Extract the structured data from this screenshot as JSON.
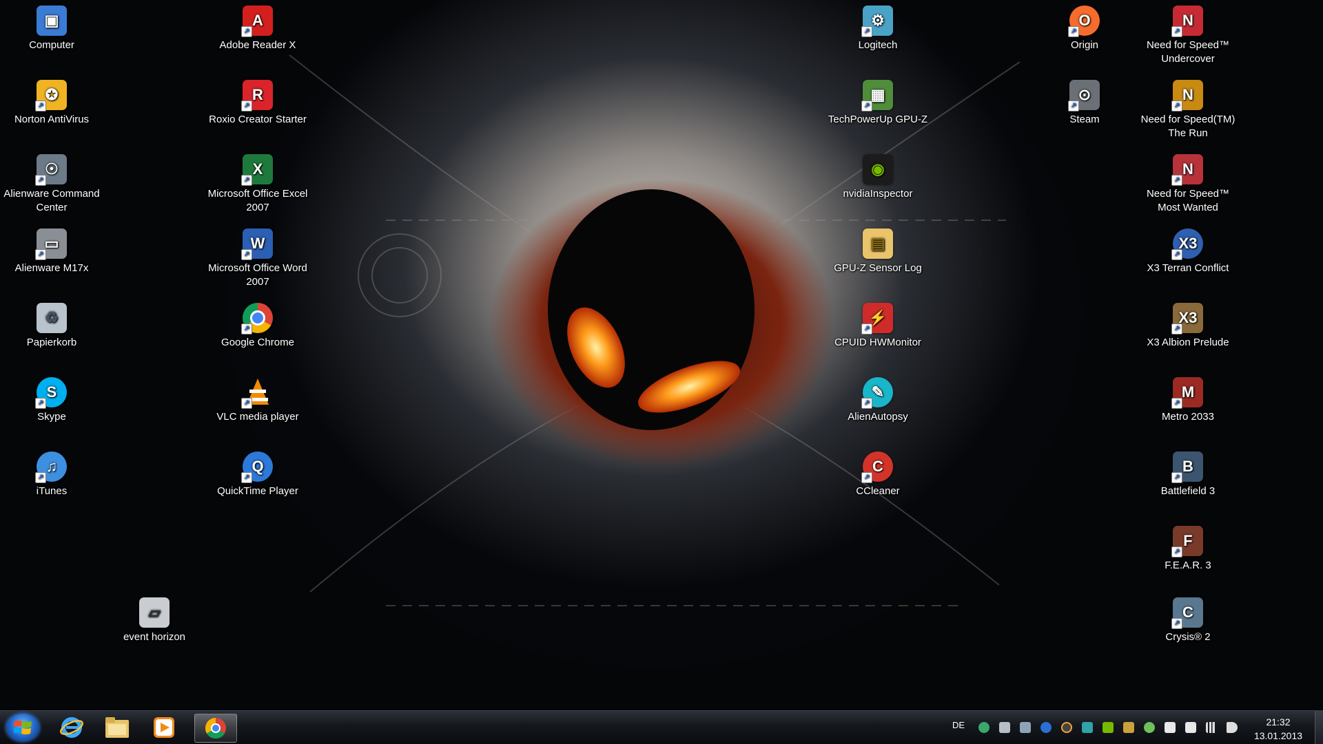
{
  "desktop": {
    "icons": [
      {
        "label": "Computer",
        "icon": "computer-icon",
        "color": "#3a7bd5"
      },
      {
        "label": "Norton AntiVirus",
        "icon": "norton-icon",
        "color": "#f0b323"
      },
      {
        "label": "Alienware Command Center",
        "icon": "alienware-cc-icon",
        "color": "#6d7a88"
      },
      {
        "label": "Alienware M17x",
        "icon": "laptop-icon",
        "color": "#8a8f96"
      },
      {
        "label": "Papierkorb",
        "icon": "recycle-bin-icon",
        "color": "#b9c3cc"
      },
      {
        "label": "Skype",
        "icon": "skype-icon",
        "color": "#00aff0"
      },
      {
        "label": "iTunes",
        "icon": "itunes-icon",
        "color": "#3d8fe0"
      },
      {
        "label": "Adobe Reader X",
        "icon": "adobe-reader-icon",
        "color": "#d3201f"
      },
      {
        "label": "Roxio Creator Starter",
        "icon": "roxio-icon",
        "color": "#d8242a"
      },
      {
        "label": "Microsoft Office Excel 2007",
        "icon": "excel-icon",
        "color": "#1e7a3c"
      },
      {
        "label": "Microsoft Office Word 2007",
        "icon": "word-icon",
        "color": "#2a5fb3"
      },
      {
        "label": "Google Chrome",
        "icon": "chrome-icon",
        "color": "#3d8b3d"
      },
      {
        "label": "VLC media player",
        "icon": "vlc-icon",
        "color": "#f28a00"
      },
      {
        "label": "QuickTime Player",
        "icon": "quicktime-icon",
        "color": "#2c79d9"
      },
      {
        "label": "event horizon",
        "icon": "monitor-icon",
        "color": "#c9ccd0"
      },
      {
        "label": "Logitech",
        "icon": "logitech-icon",
        "color": "#4aa3c7"
      },
      {
        "label": "TechPowerUp GPU-Z",
        "icon": "gpu-z-icon",
        "color": "#4f8d3a"
      },
      {
        "label": "nvidiaInspector",
        "icon": "nvidia-icon",
        "color": "#76b900"
      },
      {
        "label": "GPU-Z Sensor Log",
        "icon": "folder-icon",
        "color": "#e9c46a"
      },
      {
        "label": "CPUID HWMonitor",
        "icon": "hwmonitor-icon",
        "color": "#d02b2b"
      },
      {
        "label": "AlienAutopsy",
        "icon": "alienautopsy-icon",
        "color": "#19b5c9"
      },
      {
        "label": "CCleaner",
        "icon": "ccleaner-icon",
        "color": "#d2342a"
      },
      {
        "label": "Origin",
        "icon": "origin-icon",
        "color": "#f56c2d"
      },
      {
        "label": "Steam",
        "icon": "steam-icon",
        "color": "#6b7077"
      },
      {
        "label": "Need for Speed™ Undercover",
        "icon": "nfs-undercover-icon",
        "color": "#c62b35"
      },
      {
        "label": "Need for Speed(TM) The Run",
        "icon": "nfs-the-run-icon",
        "color": "#c98a12"
      },
      {
        "label": "Need for Speed™ Most Wanted",
        "icon": "nfs-most-wanted-icon",
        "color": "#b8323a"
      },
      {
        "label": "X3 Terran Conflict",
        "icon": "x3-terran-conflict-icon",
        "color": "#2f5fb0"
      },
      {
        "label": "X3 Albion Prelude",
        "icon": "x3-albion-prelude-icon",
        "color": "#8a6a3a"
      },
      {
        "label": "Metro 2033",
        "icon": "metro-2033-icon",
        "color": "#9b2a22"
      },
      {
        "label": "Battlefield 3",
        "icon": "battlefield-3-icon",
        "color": "#3b5570"
      },
      {
        "label": "F.E.A.R. 3",
        "icon": "fear-3-icon",
        "color": "#7a3a2a"
      },
      {
        "label": "Crysis® 2",
        "icon": "crysis-2-icon",
        "color": "#5a7790"
      }
    ]
  },
  "taskbar": {
    "start_icon": "windows-start-icon",
    "pinned": [
      {
        "name": "internet-explorer-icon"
      },
      {
        "name": "file-explorer-icon"
      },
      {
        "name": "media-player-icon"
      },
      {
        "name": "chrome-icon",
        "active": true
      }
    ],
    "language": "DE",
    "clock_time": "21:32",
    "clock_date": "13.01.2013"
  }
}
